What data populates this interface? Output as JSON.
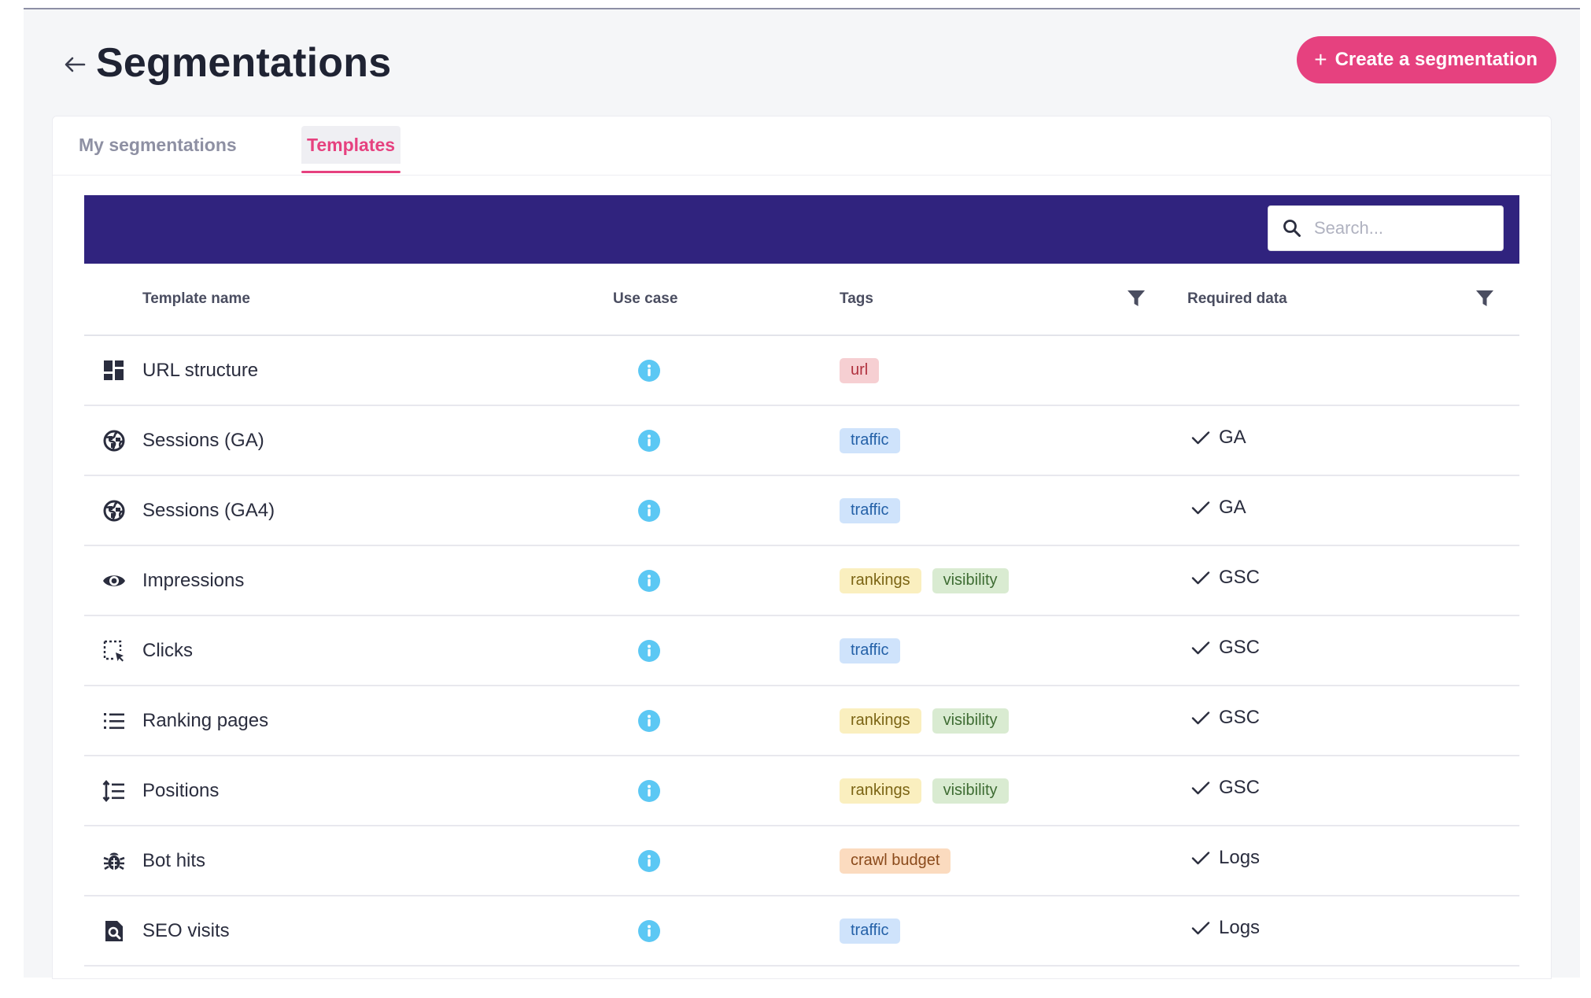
{
  "header": {
    "title": "Segmentations",
    "create_button": "Create a segmentation"
  },
  "tabs": [
    {
      "label": "My segmentations",
      "active": false
    },
    {
      "label": "Templates",
      "active": true
    }
  ],
  "search": {
    "placeholder": "Search..."
  },
  "columns": {
    "name": "Template name",
    "use_case": "Use case",
    "tags": "Tags",
    "required": "Required data"
  },
  "colors": {
    "accent": "#e6417f",
    "toolbar": "#30237e",
    "info": "#5cc8f4"
  },
  "rows": [
    {
      "icon": "dashboard-icon",
      "name": "URL structure",
      "tags": [
        {
          "label": "url",
          "type": "url"
        }
      ],
      "required": ""
    },
    {
      "icon": "globe-icon",
      "name": "Sessions (GA)",
      "tags": [
        {
          "label": "traffic",
          "type": "traffic"
        }
      ],
      "required": "GA"
    },
    {
      "icon": "globe-icon",
      "name": "Sessions (GA4)",
      "tags": [
        {
          "label": "traffic",
          "type": "traffic"
        }
      ],
      "required": "GA"
    },
    {
      "icon": "eye-icon",
      "name": "Impressions",
      "tags": [
        {
          "label": "rankings",
          "type": "rankings"
        },
        {
          "label": "visibility",
          "type": "visibility"
        }
      ],
      "required": "GSC"
    },
    {
      "icon": "click-select-icon",
      "name": "Clicks",
      "tags": [
        {
          "label": "traffic",
          "type": "traffic"
        }
      ],
      "required": "GSC"
    },
    {
      "icon": "list-icon",
      "name": "Ranking pages",
      "tags": [
        {
          "label": "rankings",
          "type": "rankings"
        },
        {
          "label": "visibility",
          "type": "visibility"
        }
      ],
      "required": "GSC"
    },
    {
      "icon": "sort-list-icon",
      "name": "Positions",
      "tags": [
        {
          "label": "rankings",
          "type": "rankings"
        },
        {
          "label": "visibility",
          "type": "visibility"
        }
      ],
      "required": "GSC"
    },
    {
      "icon": "bug-icon",
      "name": "Bot hits",
      "tags": [
        {
          "label": "crawl budget",
          "type": "crawl"
        }
      ],
      "required": "Logs"
    },
    {
      "icon": "find-page-icon",
      "name": "SEO visits",
      "tags": [
        {
          "label": "traffic",
          "type": "traffic"
        }
      ],
      "required": "Logs"
    }
  ]
}
